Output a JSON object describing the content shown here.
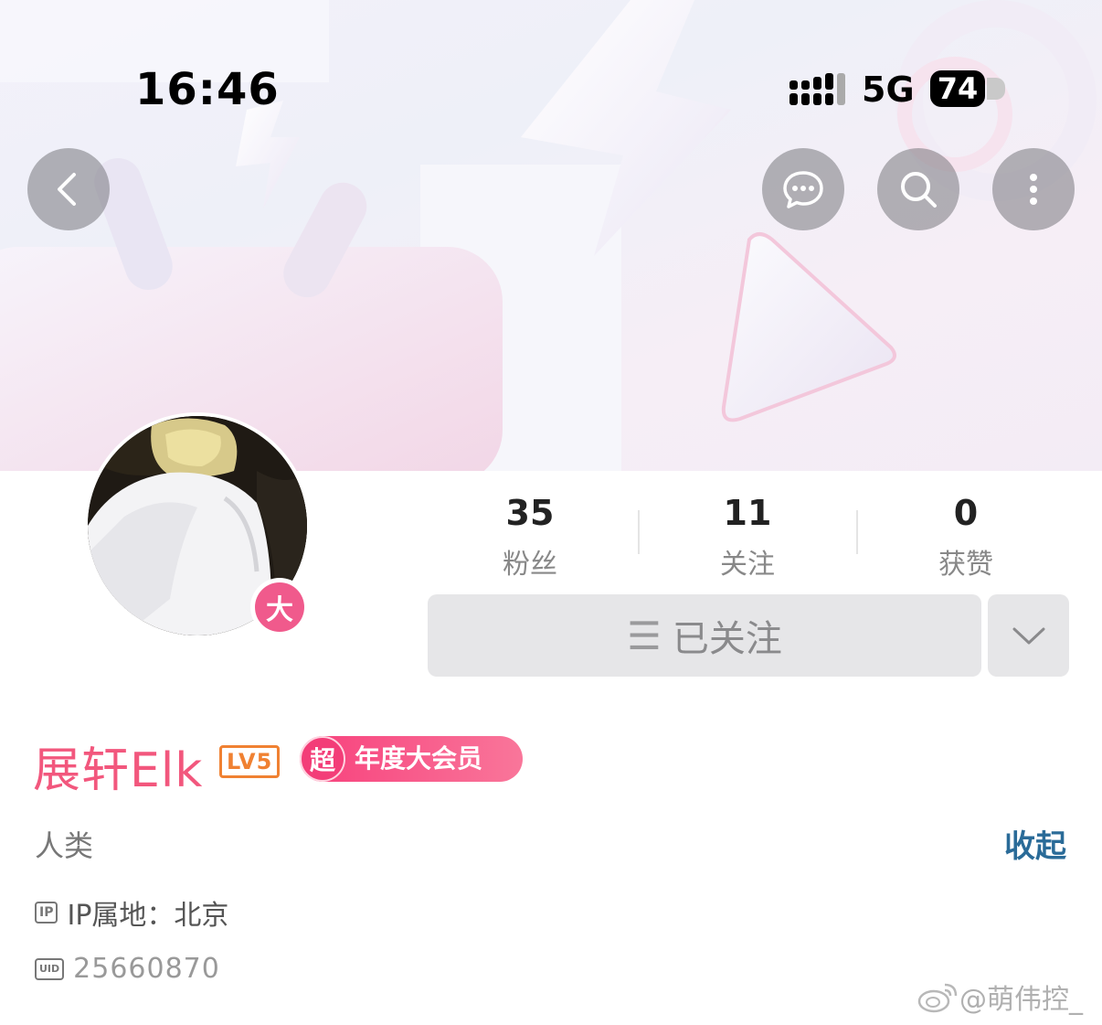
{
  "status_bar": {
    "time": "16:46",
    "network": "5G",
    "battery": "74"
  },
  "header_buttons": [
    "back-icon",
    "chat-icon",
    "search-icon",
    "more-icon"
  ],
  "stats": [
    {
      "value": "35",
      "label": "粉丝"
    },
    {
      "value": "11",
      "label": "关注"
    },
    {
      "value": "0",
      "label": "获赞"
    }
  ],
  "follow": {
    "label": "已关注",
    "menu_glyph": "☰"
  },
  "avatar_badge": "大",
  "profile": {
    "name": "展轩Elk",
    "level": "LV5",
    "vip_icon": "超",
    "vip_text": "年度大会员",
    "bio": "人类",
    "collapse": "收起",
    "ip_tag": "IP",
    "ip": "IP属地：北京",
    "uid_tag": "UID",
    "uid": "25660870"
  },
  "watermark": "@萌伟控_",
  "colors": {
    "name": "#f2577d",
    "level": "#f08132",
    "vip": "#f7407c",
    "link": "#2a6b98"
  }
}
